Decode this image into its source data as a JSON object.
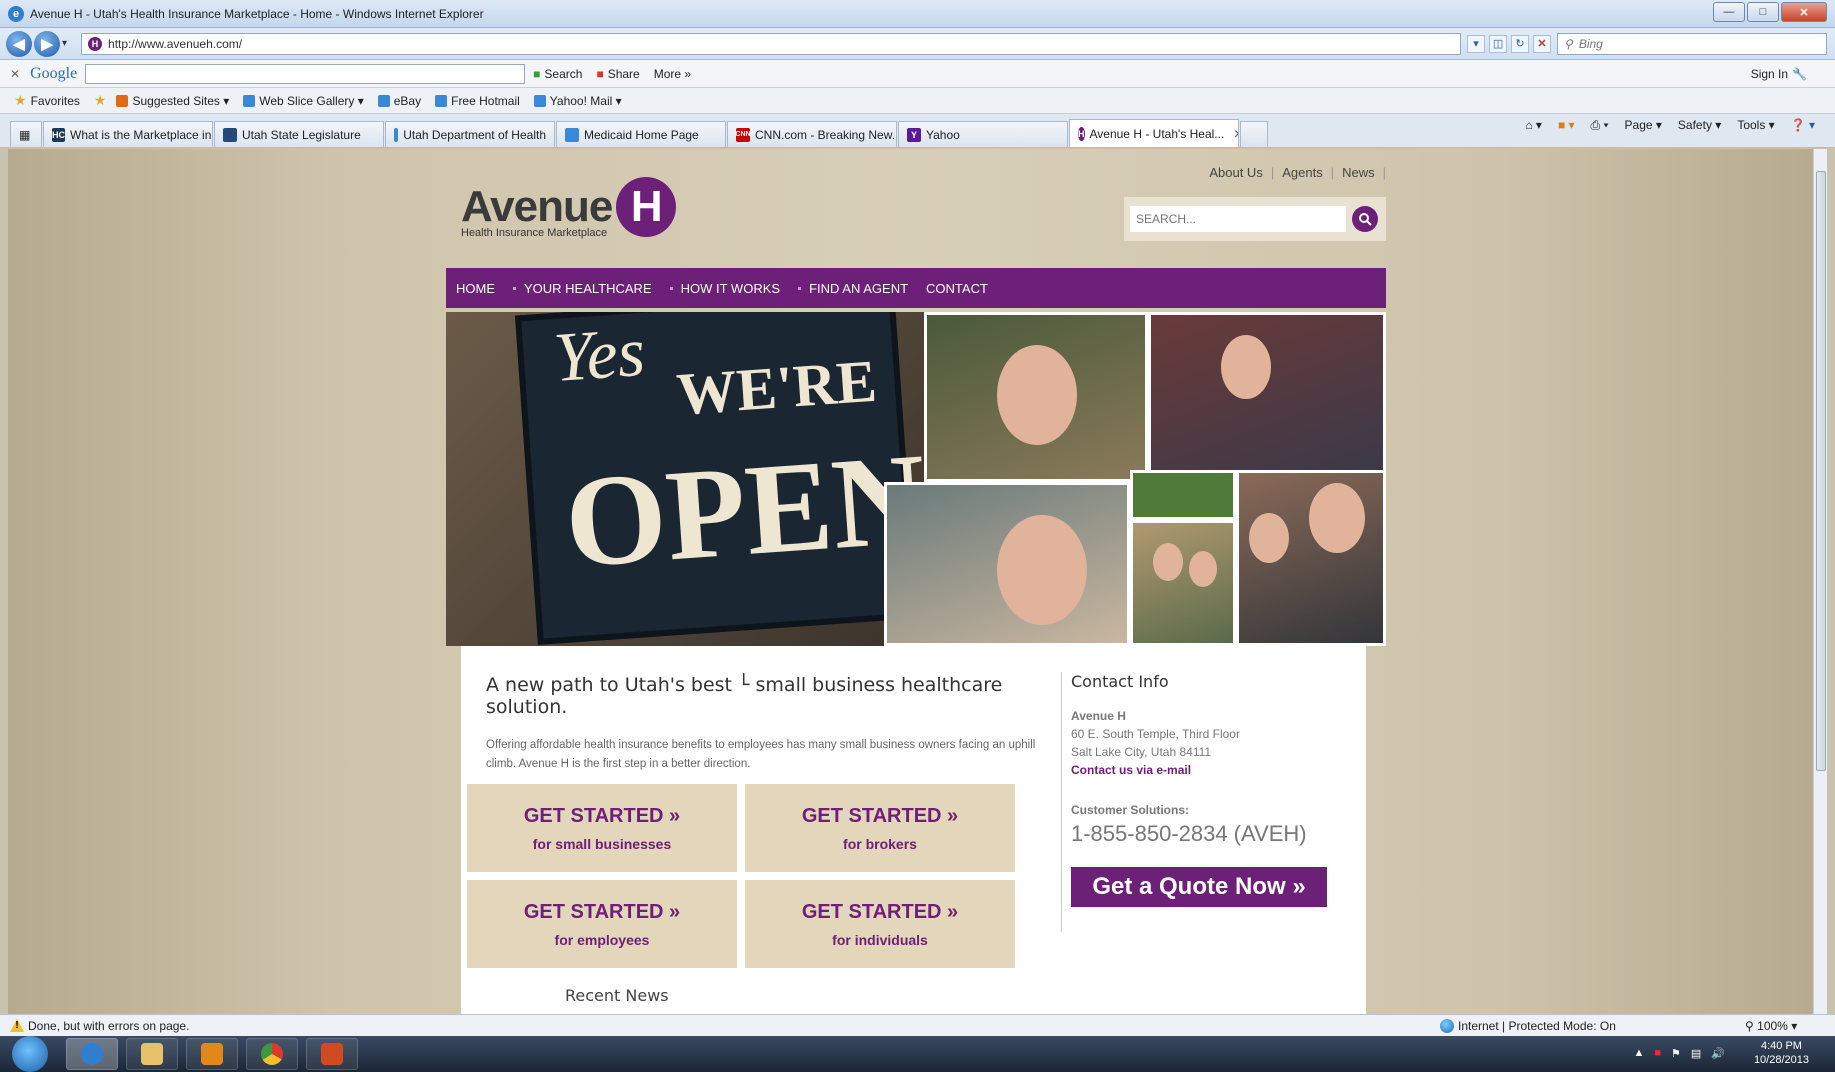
{
  "window": {
    "title": "Avenue H - Utah's Health Insurance Marketplace - Home - Windows Internet Explorer",
    "url": "http://www.avenueh.com/",
    "search_placeholder": "Bing"
  },
  "google_toolbar": {
    "logo": "Google",
    "search_label": "Search",
    "share_label": "Share",
    "more_label": "More »",
    "signin_label": "Sign In"
  },
  "favorites_bar": {
    "favorites_label": "Favorites",
    "items": [
      "Suggested Sites ▾",
      "Web Slice Gallery ▾",
      "eBay",
      "Free Hotmail",
      "Yahoo! Mail ▾"
    ]
  },
  "tabs": [
    {
      "label": "What is the Marketplace in...",
      "icon_text": "HC",
      "color": "#1a3a5a"
    },
    {
      "label": "Utah State Legislature",
      "icon_text": "",
      "color": "#234a7a"
    },
    {
      "label": "Utah Department of Health",
      "icon_text": "",
      "color": "#3b88d8"
    },
    {
      "label": "Medicaid Home Page",
      "icon_text": "",
      "color": "#3b88d8"
    },
    {
      "label": "CNN.com - Breaking New...",
      "icon_text": "CNN",
      "color": "#cc0000"
    },
    {
      "label": "Yahoo",
      "icon_text": "Y",
      "color": "#5b1a9a"
    },
    {
      "label": "Avenue H - Utah's Heal...",
      "icon_text": "H",
      "color": "#6d2077",
      "active": true
    }
  ],
  "command_bar": {
    "page": "Page ▾",
    "safety": "Safety ▾",
    "tools": "Tools ▾"
  },
  "site": {
    "toplinks": [
      "About Us",
      "Agents",
      "News"
    ],
    "logo_word": "Avenue",
    "logo_letter": "H",
    "logo_tagline": "Health Insurance Marketplace",
    "search_placeholder": "SEARCH...",
    "nav": [
      "HOME",
      "YOUR HEALTHCARE",
      "HOW IT WORKS",
      "FIND AN AGENT",
      "CONTACT"
    ],
    "hero": {
      "sign_yes": "Yes",
      "sign_were": "WE'RE",
      "sign_open": "OPEN"
    },
    "headline": "A new path to Utah's best └ small business healthcare solution.",
    "intro": "Offering affordable health insurance benefits to employees has many small business owners facing an uphill climb. Avenue H is the first step in a better direction.",
    "ctas": [
      {
        "title": "GET STARTED »",
        "sub": "for small businesses"
      },
      {
        "title": "GET STARTED »",
        "sub": "for brokers"
      },
      {
        "title": "GET STARTED »",
        "sub": "for employees"
      },
      {
        "title": "GET STARTED »",
        "sub": "for individuals"
      }
    ],
    "recent_news": "Recent News",
    "contact": {
      "title": "Contact Info",
      "name": "Avenue H",
      "address1": "60 E. South Temple, Third Floor",
      "address2": "Salt Lake City, Utah 84111",
      "email_link": "Contact us via e-mail",
      "cs_label": "Customer Solutions:",
      "phone": "1-855-850-2834 (AVEH)",
      "quote_button": "Get a Quote Now »"
    }
  },
  "status": {
    "text": "Done, but with errors on page.",
    "zone": "Internet | Protected Mode: On",
    "zoom": "100%"
  },
  "clock": {
    "time": "4:40 PM",
    "date": "10/28/2013"
  },
  "colors": {
    "brand_purple": "#6d2077",
    "cta_tan": "#e3d6bb"
  }
}
